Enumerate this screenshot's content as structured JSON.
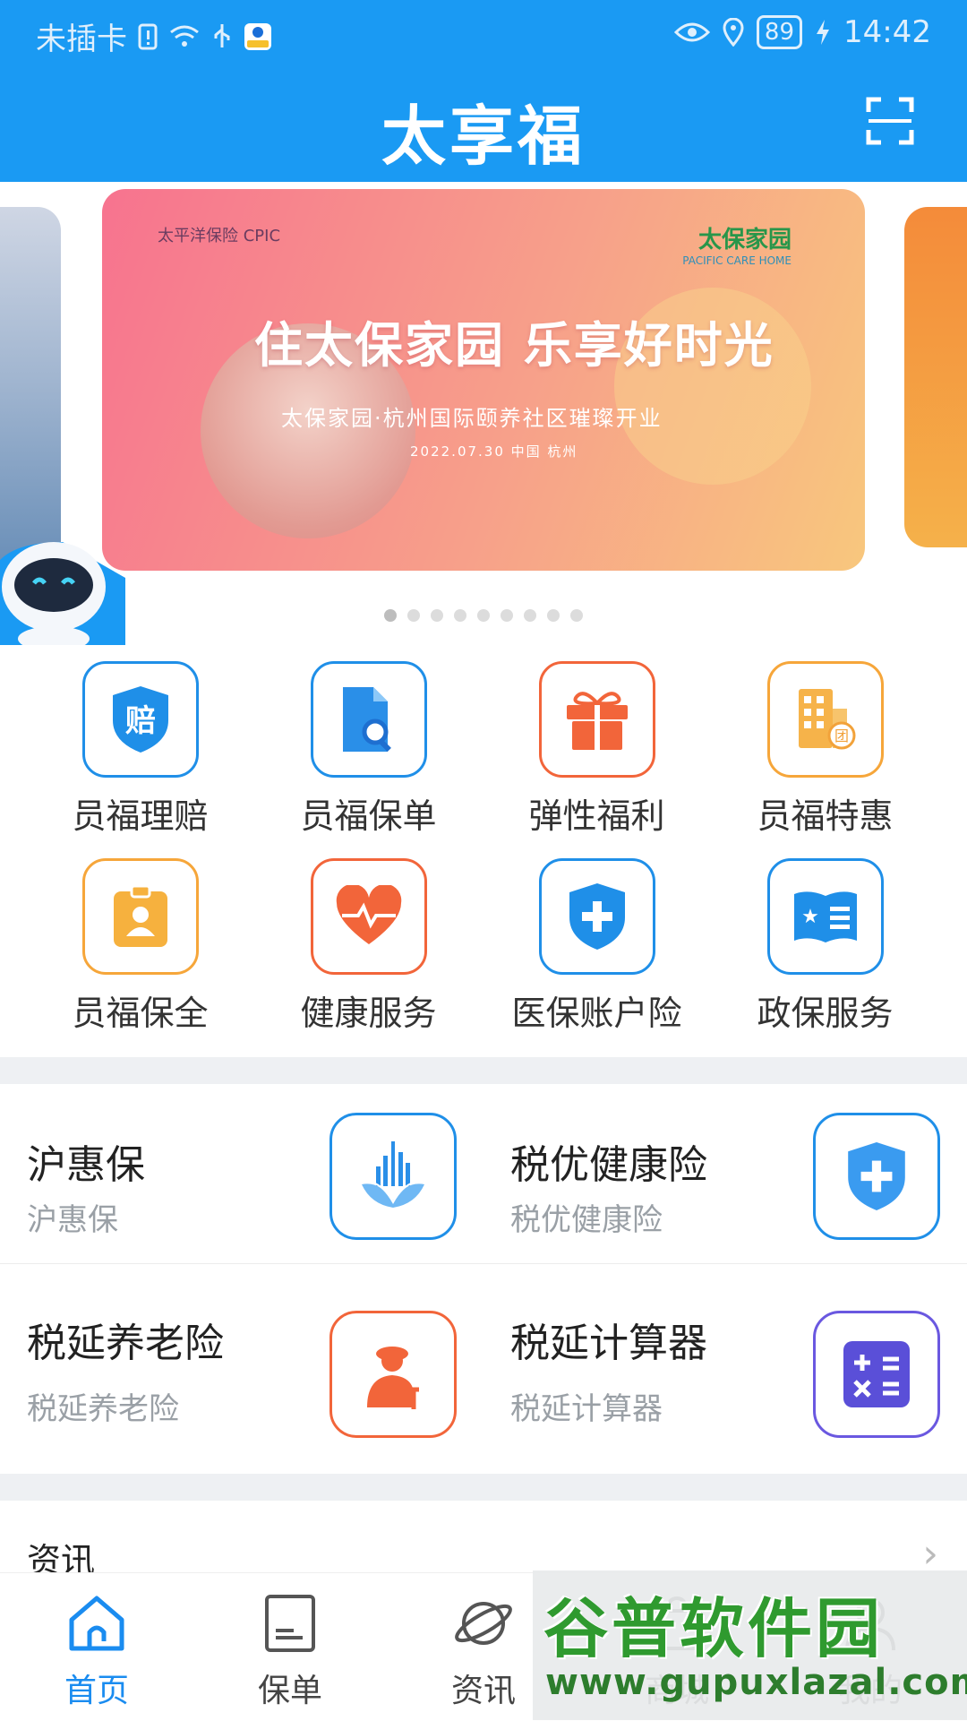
{
  "status_bar": {
    "carrier": "未插卡",
    "battery": "89",
    "time": "14:42"
  },
  "app": {
    "title": "太享福"
  },
  "banner": {
    "logo_left": "太平洋保险 CPIC",
    "logo_right": "太保家园",
    "logo_right_en": "PACIFIC CARE HOME",
    "headline": "住太保家园 乐享好时光",
    "subtitle": "太保家园·杭州国际颐养社区璀璨开业",
    "date": "2022.07.30  中国 杭州",
    "dots_total": 9,
    "active_index": 0
  },
  "quick_menu": [
    {
      "label": "员福理赔",
      "icon": "claim-shield-icon",
      "color": "#1f8fe8"
    },
    {
      "label": "员福保单",
      "icon": "policy-search-icon",
      "color": "#1f8fe8"
    },
    {
      "label": "弹性福利",
      "icon": "gift-icon",
      "color": "#f2653a"
    },
    {
      "label": "员福特惠",
      "icon": "building-discount-icon",
      "color": "#f6a63a"
    },
    {
      "label": "员福保全",
      "icon": "badge-person-icon",
      "color": "#f6a63a"
    },
    {
      "label": "健康服务",
      "icon": "heart-pulse-icon",
      "color": "#f2653a"
    },
    {
      "label": "医保账户险",
      "icon": "medical-shield-icon",
      "color": "#1f8fe8"
    },
    {
      "label": "政保服务",
      "icon": "government-book-icon",
      "color": "#1f8fe8"
    }
  ],
  "products": [
    {
      "name": "沪惠保",
      "sub": "沪惠保",
      "icon": "shanghai-skyline-icon",
      "color": "#1f8fe8"
    },
    {
      "name": "税优健康险",
      "sub": "税优健康险",
      "icon": "health-shield-icon",
      "color": "#1f8fe8"
    },
    {
      "name": "税延养老险",
      "sub": "税延养老险",
      "icon": "elderly-person-icon",
      "color": "#f2653a"
    },
    {
      "name": "税延计算器",
      "sub": "税延计算器",
      "icon": "calculator-icon",
      "color": "#6a58e0"
    }
  ],
  "news": {
    "title": "资讯"
  },
  "tabs": [
    {
      "label": "首页",
      "icon": "home-icon",
      "active": true
    },
    {
      "label": "保单",
      "icon": "policy-doc-icon",
      "active": false
    },
    {
      "label": "资讯",
      "icon": "planet-icon",
      "active": false
    },
    {
      "label": "商城",
      "icon": "shop-icon",
      "active": false
    },
    {
      "label": "我的",
      "icon": "profile-icon",
      "active": false
    }
  ],
  "watermark": {
    "main": "谷普软件园",
    "url": "www.gupuxlazal.com"
  },
  "colors": {
    "brand_blue": "#1a9af3",
    "active_tab": "#1a8cf0"
  }
}
